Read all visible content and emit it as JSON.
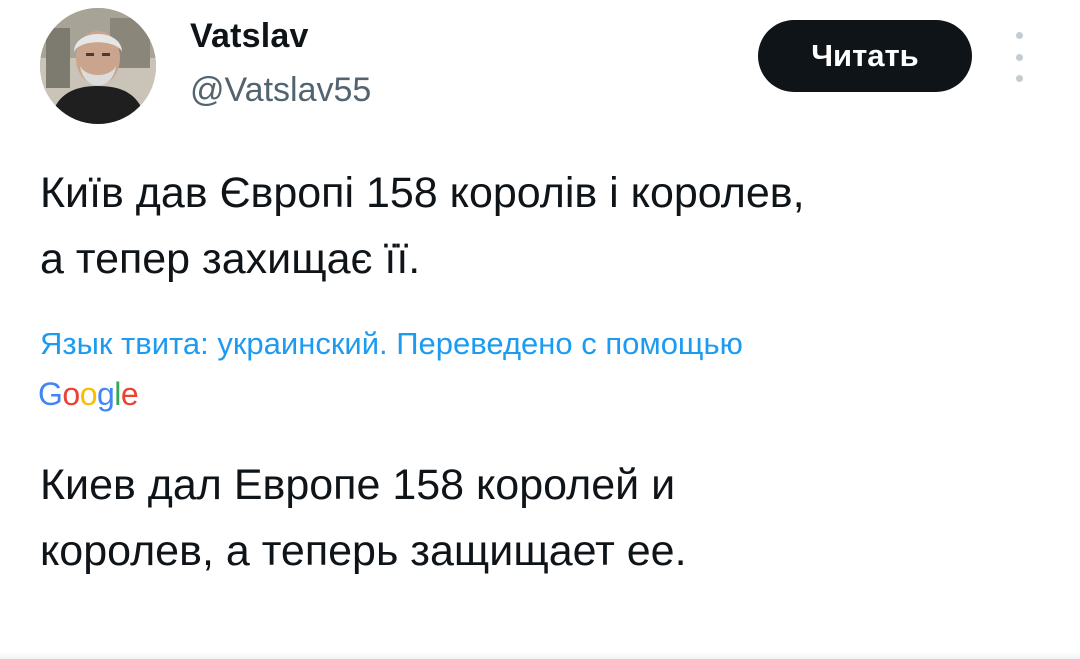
{
  "author": {
    "display_name": "Vatslav",
    "handle": "@Vatslav55"
  },
  "follow_button": {
    "label": "Читать"
  },
  "tweet": {
    "text_line1": "Київ дав Європі 158 королів і королев,",
    "text_line2": "а тепер захищає її."
  },
  "translation": {
    "note": "Язык твита: украинский. Переведено с помощью",
    "provider_logo": [
      "G",
      "o",
      "o",
      "g",
      "l",
      "e"
    ],
    "text_line1": "Киев дал Европе 158 королей и",
    "text_line2": "королев, а теперь защищает ее."
  },
  "colors": {
    "accent_link": "#1d9bf0",
    "button_bg": "#0f1419",
    "secondary_text": "#536471"
  },
  "icons": {
    "more": "more-vertical-icon"
  }
}
